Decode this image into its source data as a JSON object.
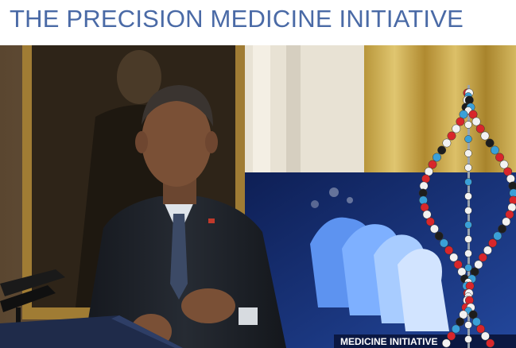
{
  "header": {
    "title": "THE PRECISION MEDICINE INITIATIVE"
  },
  "photo": {
    "screen_caption": "MEDICINE INITIATIVE",
    "flag_pin": "american-flag-pin-icon"
  },
  "colors": {
    "title_blue": "#4a6aa6",
    "curtain_gold": "#c9a94a",
    "screen_blue": "#1e3a8a",
    "silhouette_light": "#9ec5ff"
  }
}
